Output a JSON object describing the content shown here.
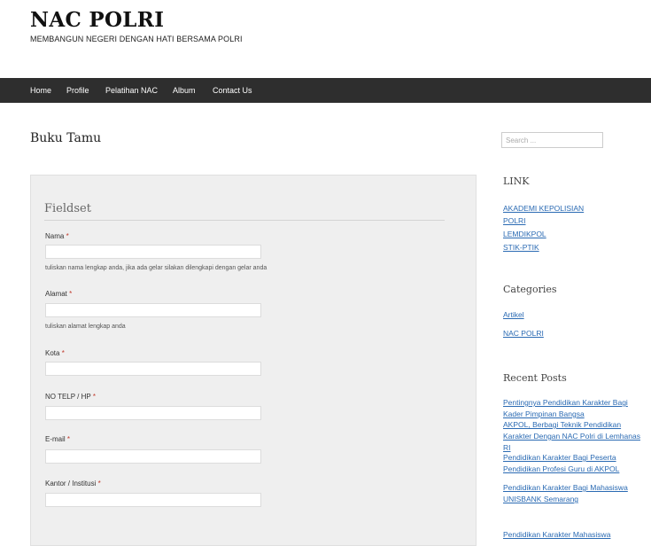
{
  "site": {
    "title": "NAC POLRI",
    "description": "MEMBANGUN NEGERI DENGAN HATI BERSAMA POLRI"
  },
  "nav": {
    "items": [
      "Home",
      "Profile",
      "Pelatihan NAC",
      "Album",
      "Contact Us"
    ]
  },
  "page": {
    "title": "Buku Tamu"
  },
  "form": {
    "fieldset_title": "Fieldset",
    "fields": [
      {
        "label": "Nama",
        "required_mark": "*",
        "help": "tuliskan nama lengkap anda, jika ada gelar silakan dilengkapi dengan gelar anda"
      },
      {
        "label": "Alamat",
        "required_mark": "*",
        "help": "tuliskan alamat lengkap anda"
      },
      {
        "label": "Kota",
        "required_mark": "*",
        "help": ""
      },
      {
        "label": "NO TELP / HP",
        "required_mark": "*",
        "help": ""
      },
      {
        "label": "E-mail",
        "required_mark": "*",
        "help": ""
      },
      {
        "label": "Kantor / Institusi",
        "required_mark": "*",
        "help": ""
      }
    ]
  },
  "sidebar": {
    "search_placeholder": "Search ...",
    "link_widget": {
      "title": "LINK",
      "items": [
        "AKADEMI KEPOLISIAN",
        "POLRI",
        "LEMDIKPOL",
        "STIK-PTIK"
      ]
    },
    "categories_widget": {
      "title": "Categories",
      "items": [
        "Artikel",
        "NAC POLRI"
      ]
    },
    "recent_posts_widget": {
      "title": "Recent Posts",
      "items": [
        "Pentingnya Pendidikan Karakter Bagi Kader Pimpinan Bangsa",
        "AKPOL, Berbagi Teknik Pendidikan Karakter Dengan NAC Polri di Lemhanas RI",
        "Pendidikan Karakter Bagi Peserta Pendidikan Profesi Guru di AKPOL",
        "Pendidikan Karakter Bagi Mahasiswa UNISBANK Semarang",
        "Pendidikan Karakter Mahasiswa"
      ]
    }
  }
}
